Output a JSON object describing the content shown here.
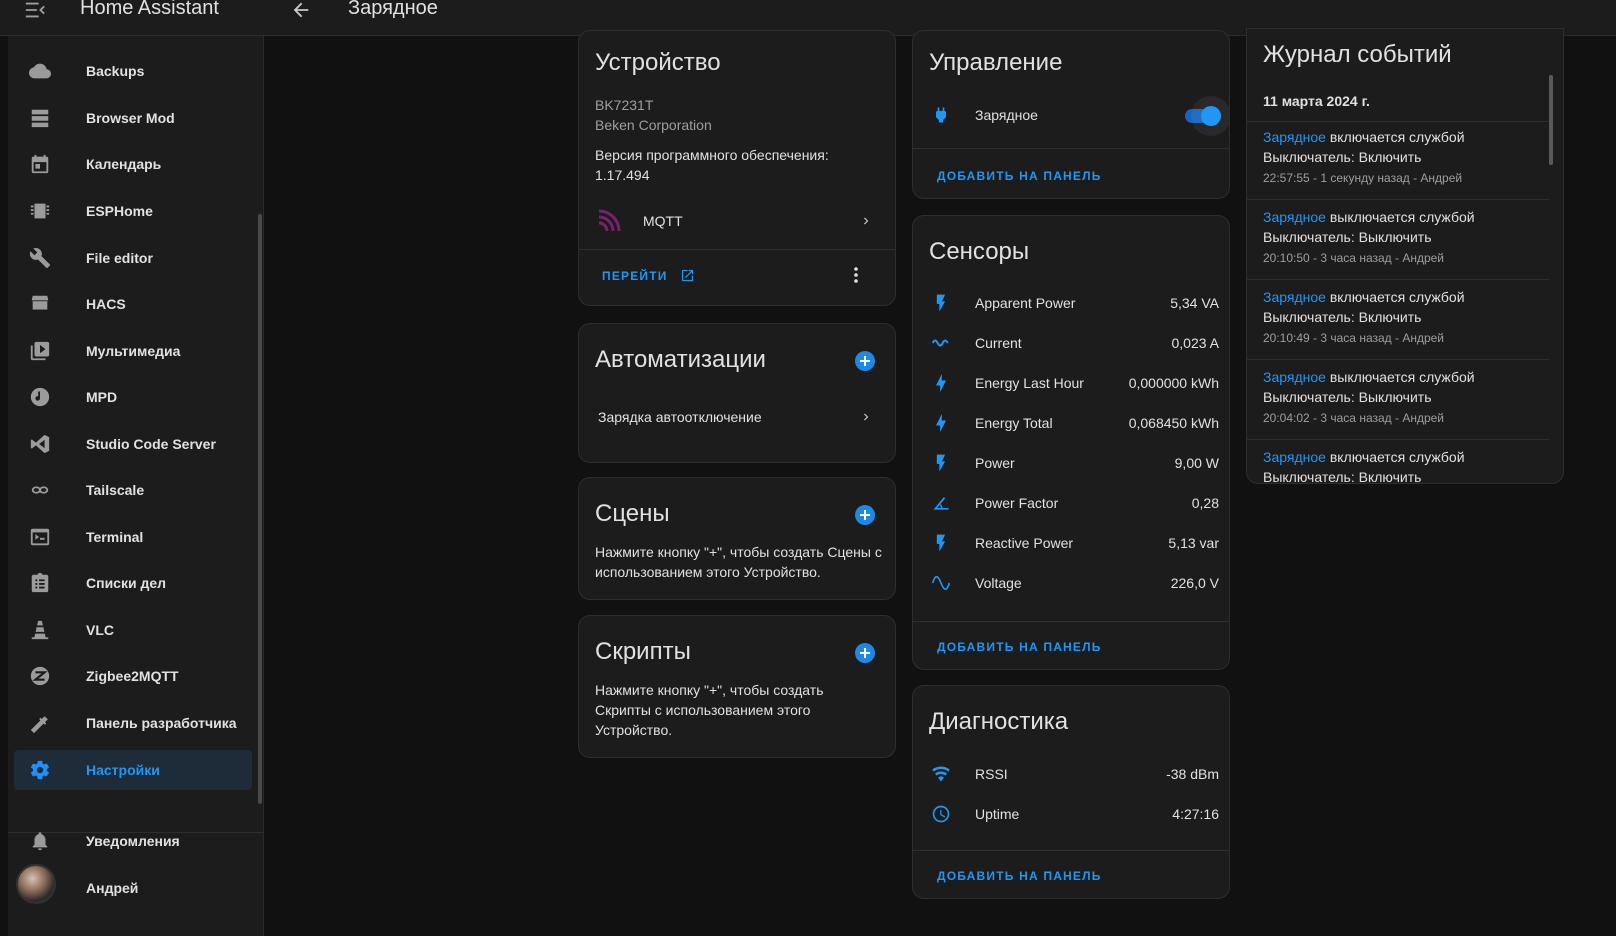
{
  "topbar": {
    "app_title": "Home Assistant",
    "page_title": "Зарядное"
  },
  "sidebar": {
    "items": [
      {
        "label": "Backups",
        "icon": "cloud-icon"
      },
      {
        "label": "Browser Mod",
        "icon": "server-icon"
      },
      {
        "label": "Календарь",
        "icon": "calendar-icon"
      },
      {
        "label": "ESPHome",
        "icon": "chip-icon"
      },
      {
        "label": "File editor",
        "icon": "wrench-icon"
      },
      {
        "label": "HACS",
        "icon": "hacs-icon"
      },
      {
        "label": "Мультимедиа",
        "icon": "play-box-icon"
      },
      {
        "label": "MPD",
        "icon": "music-note-icon"
      },
      {
        "label": "Studio Code Server",
        "icon": "vscode-icon"
      },
      {
        "label": "Tailscale",
        "icon": "tailscale-icon"
      },
      {
        "label": "Terminal",
        "icon": "console-icon"
      },
      {
        "label": "Списки дел",
        "icon": "clipboard-list-icon"
      },
      {
        "label": "VLC",
        "icon": "traffic-cone-icon"
      },
      {
        "label": "Zigbee2MQTT",
        "icon": "zigbee-icon"
      },
      {
        "label": "Панель разработчика",
        "icon": "hammer-icon"
      },
      {
        "label": "Настройки",
        "icon": "gear-icon",
        "active": true
      }
    ],
    "notifications_label": "Уведомления",
    "user_label": "Андрей"
  },
  "device": {
    "title": "Устройство",
    "model": "BK7231T",
    "manufacturer": "Beken Corporation",
    "firmware": "Версия программного обеспечения: 1.17.494",
    "integration": "MQTT",
    "visit_label": "ПЕРЕЙТИ"
  },
  "automations": {
    "title": "Автоматизации",
    "items": [
      "Зарядка автоотключение"
    ]
  },
  "scenes": {
    "title": "Сцены",
    "text": "Нажмите кнопку \"+\", чтобы создать Сцены с использованием этого Устройство."
  },
  "scripts": {
    "title": "Скрипты",
    "text": "Нажмите кнопку \"+\", чтобы создать Скрипты с использованием этого Устройство."
  },
  "controls": {
    "title": "Управление",
    "switch_name": "Зарядное",
    "switch_on": true,
    "add_label": "ДОБАВИТЬ НА ПАНЕЛЬ"
  },
  "sensors": {
    "title": "Сенсоры",
    "rows": [
      {
        "name": "Apparent Power",
        "value": "5,34 VA",
        "icon": "flash-icon"
      },
      {
        "name": "Current",
        "value": "0,023 A",
        "icon": "current-ac-icon"
      },
      {
        "name": "Energy Last Hour",
        "value": "0,000000 kWh",
        "icon": "lightning-bolt-icon"
      },
      {
        "name": "Energy Total",
        "value": "0,068450 kWh",
        "icon": "lightning-bolt-icon"
      },
      {
        "name": "Power",
        "value": "9,00 W",
        "icon": "flash-icon"
      },
      {
        "name": "Power Factor",
        "value": "0,28",
        "icon": "angle-acute-icon"
      },
      {
        "name": "Reactive Power",
        "value": "5,13 var",
        "icon": "flash-icon"
      },
      {
        "name": "Voltage",
        "value": "226,0 V",
        "icon": "sine-wave-icon"
      }
    ],
    "add_label": "ДОБАВИТЬ НА ПАНЕЛЬ"
  },
  "diagnostics": {
    "title": "Диагностика",
    "rows": [
      {
        "name": "RSSI",
        "value": "-38 dBm",
        "icon": "wifi-icon"
      },
      {
        "name": "Uptime",
        "value": "4:27:16",
        "icon": "clock-icon"
      }
    ],
    "add_label": "ДОБАВИТЬ НА ПАНЕЛЬ"
  },
  "logbook": {
    "title": "Журнал событий",
    "date": "11 марта 2024 г.",
    "entries": [
      {
        "entity": "Зарядное",
        "action": " включается службой",
        "detail": "Выключатель: Включить",
        "time": "22:57:55 - 1 секунду назад - Андрей"
      },
      {
        "entity": "Зарядное",
        "action": " выключается службой",
        "detail": "Выключатель: Выключить",
        "time": "20:10:50 - 3 часа назад - Андрей"
      },
      {
        "entity": "Зарядное",
        "action": " включается службой",
        "detail": "Выключатель: Включить",
        "time": "20:10:49 - 3 часа назад - Андрей"
      },
      {
        "entity": "Зарядное",
        "action": " выключается службой",
        "detail": "Выключатель: Выключить",
        "time": "20:04:02 - 3 часа назад - Андрей"
      },
      {
        "entity": "Зарядное",
        "action": " включается службой",
        "detail": "Выключатель: Включить",
        "time": ""
      }
    ]
  }
}
